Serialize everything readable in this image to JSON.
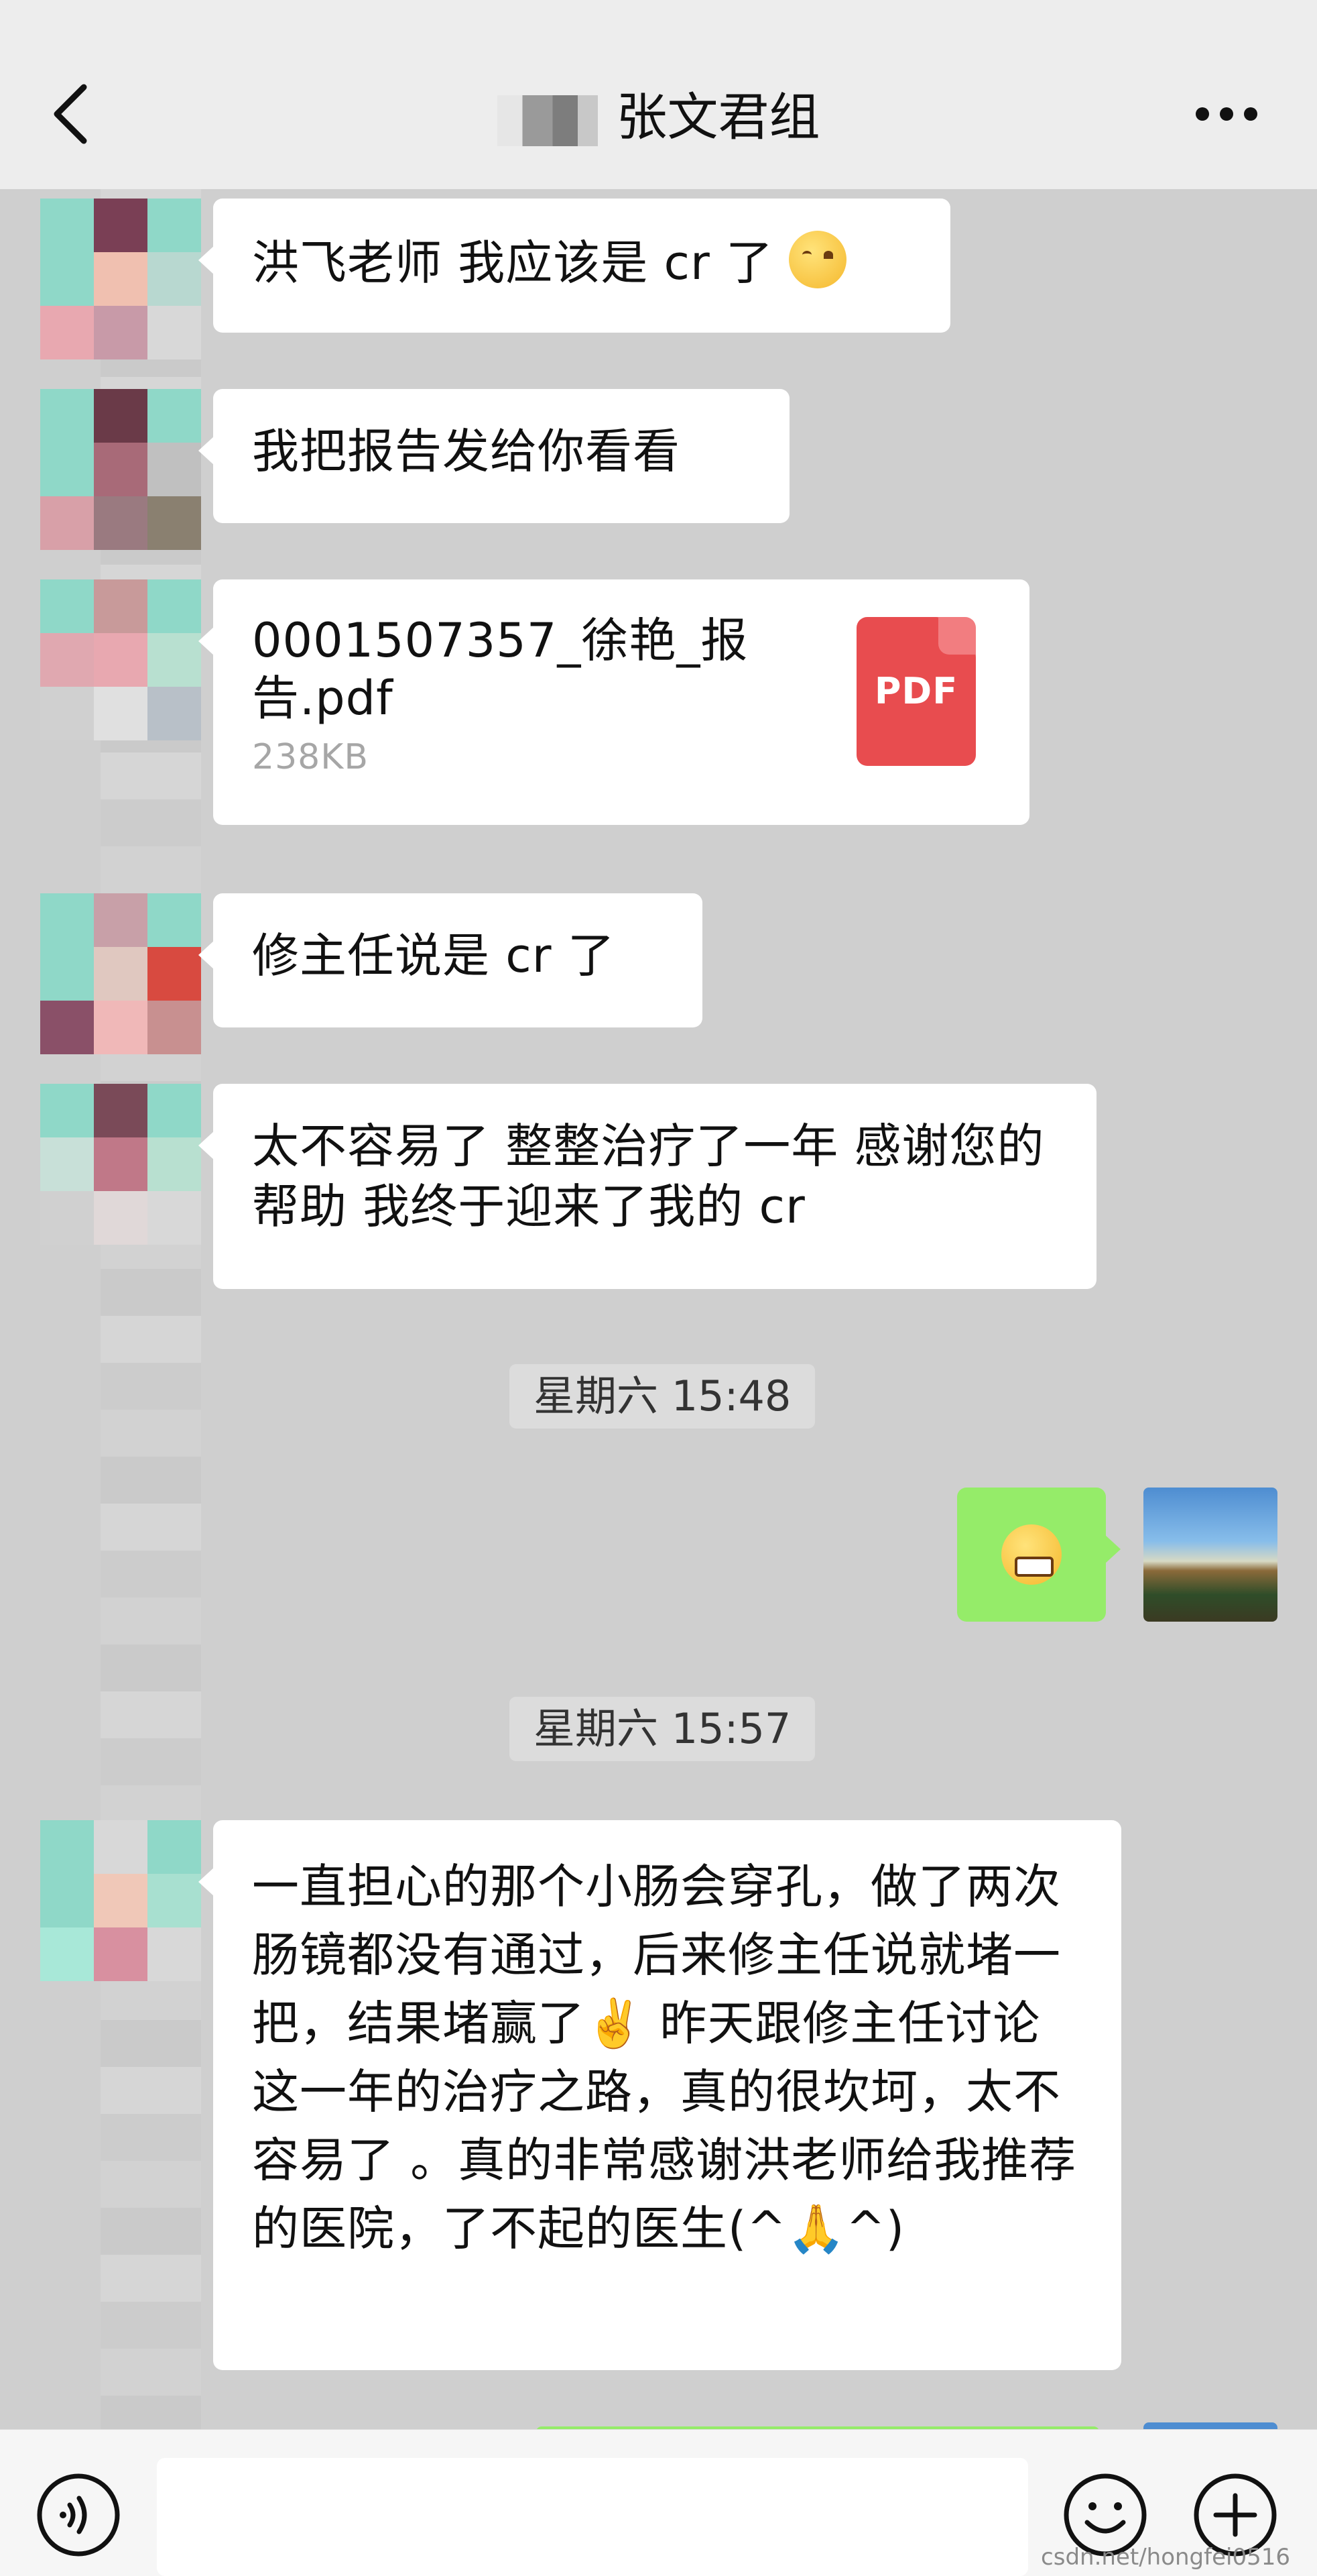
{
  "header": {
    "title": "张文君组",
    "back_icon": "chevron-left-icon",
    "more_icon": "more-dots-icon"
  },
  "messages": [
    {
      "sender": "other",
      "type": "text",
      "text": "洪飞老师 我应该是 cr 了",
      "emoji": "smiling-face-emoji"
    },
    {
      "sender": "other",
      "type": "text",
      "text": "我把报告发给你看看"
    },
    {
      "sender": "other",
      "type": "file",
      "file_name": "0001507357_徐艳_报告.pdf",
      "file_size": "238KB",
      "file_icon": "PDF"
    },
    {
      "sender": "other",
      "type": "text",
      "text": "修主任说是 cr 了"
    },
    {
      "sender": "other",
      "type": "text",
      "text": "太不容易了 整整治疗了一年 感谢您的帮助 我终于迎来了我的 cr"
    },
    {
      "type": "timestamp",
      "text": "星期六 15:48"
    },
    {
      "sender": "self",
      "type": "emoji",
      "emoji": "grinning-face-emoji"
    },
    {
      "type": "timestamp",
      "text": "星期六 15:57"
    },
    {
      "sender": "other",
      "type": "text",
      "text_before": "一直担心的那个小肠会穿孔，做了两次肠镜都没有通过，后来修主任说就堵一把，结果堵赢了",
      "emoji_mid": "✌️",
      "text_after": " 昨天跟修主任讨论这一年的治疗之路，真的很坎坷，太不容易了 。真的非常感谢洪老师给我推荐的医院，了不起的医生(^🙏^)"
    }
  ],
  "input_bar": {
    "voice_icon": "voice-icon",
    "emoji_icon": "emoji-icon",
    "plus_icon": "plus-icon",
    "watermark": "csdn.net/hongfei0516"
  },
  "colors": {
    "chat_background": "#cfcfcf",
    "self_bubble": "#95ec69",
    "other_bubble": "#ffffff",
    "pdf_red": "#e84c4f"
  }
}
